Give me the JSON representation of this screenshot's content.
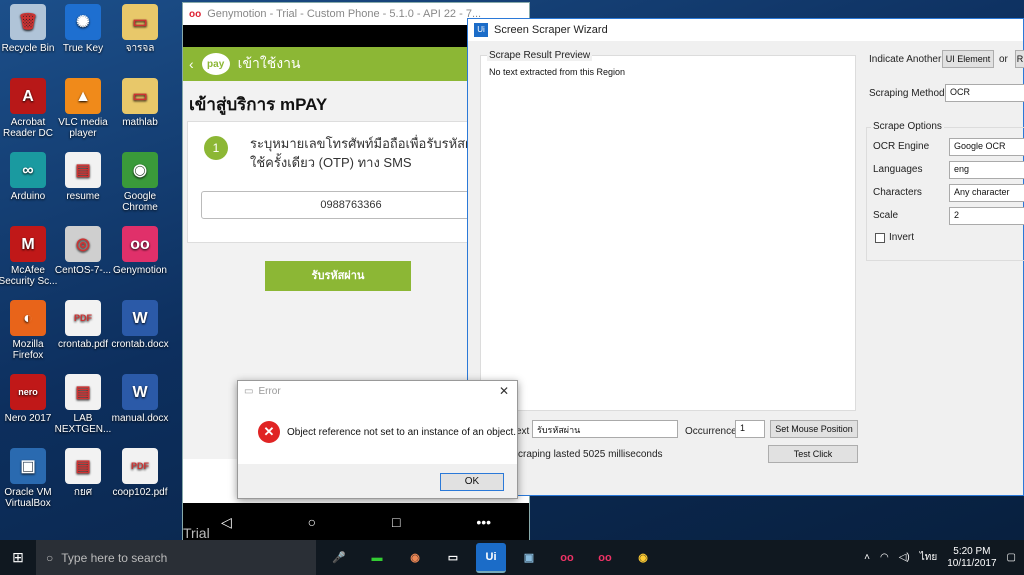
{
  "desktop": {
    "icons": [
      {
        "label": "Recycle Bin",
        "icon": "recycle-bin-icon",
        "color": "#b0c4d8",
        "glyph": "🗑"
      },
      {
        "label": "True Key",
        "icon": "true-key-icon",
        "color": "#1e6fd0",
        "glyph": "✺"
      },
      {
        "label": "จารจล",
        "icon": "folder-icon",
        "color": "#e8c86a",
        "glyph": "▭"
      },
      {
        "label": "Acrobat Reader DC",
        "icon": "acrobat-icon",
        "color": "#b81818",
        "glyph": "A"
      },
      {
        "label": "VLC media player",
        "icon": "vlc-icon",
        "color": "#f08a1a",
        "glyph": "▲"
      },
      {
        "label": "mathlab",
        "icon": "folder-icon",
        "color": "#e8c86a",
        "glyph": "▭"
      },
      {
        "label": "Arduino",
        "icon": "arduino-icon",
        "color": "#1a9aa0",
        "glyph": "∞"
      },
      {
        "label": "resume",
        "icon": "pdf-file-icon",
        "color": "#f2f2f2",
        "glyph": "▤"
      },
      {
        "label": "Google Chrome",
        "icon": "chrome-icon",
        "color": "#3a9a3a",
        "glyph": "◉"
      },
      {
        "label": "McAfee Security Sc...",
        "icon": "mcafee-icon",
        "color": "#c01818",
        "glyph": "M"
      },
      {
        "label": "CentOS-7-...",
        "icon": "disc-icon",
        "color": "#cfcfcf",
        "glyph": "◎"
      },
      {
        "label": "Genymotion",
        "icon": "genymotion-icon",
        "color": "#e0306a",
        "glyph": "oo"
      },
      {
        "label": "Mozilla Firefox",
        "icon": "firefox-icon",
        "color": "#e8641a",
        "glyph": "◐"
      },
      {
        "label": "crontab.pdf",
        "icon": "pdf-file-icon",
        "color": "#f2f2f2",
        "glyph": "PDF"
      },
      {
        "label": "crontab.docx",
        "icon": "word-file-icon",
        "color": "#2b5aa8",
        "glyph": "W"
      },
      {
        "label": "Nero 2017",
        "icon": "nero-icon",
        "color": "#c01818",
        "glyph": "nero"
      },
      {
        "label": "LAB NEXTGEN...",
        "icon": "file-icon",
        "color": "#f2f2f2",
        "glyph": "▤"
      },
      {
        "label": "manual.docx",
        "icon": "word-file-icon",
        "color": "#2b5aa8",
        "glyph": "W"
      },
      {
        "label": "Oracle VM VirtualBox",
        "icon": "virtualbox-icon",
        "color": "#2a6ab0",
        "glyph": "▣"
      },
      {
        "label": "กยศ",
        "icon": "file-icon",
        "color": "#f2f2f2",
        "glyph": "▤"
      },
      {
        "label": "coop102.pdf",
        "icon": "pdf-file-icon",
        "color": "#f2f2f2",
        "glyph": "PDF"
      }
    ]
  },
  "genymotion": {
    "title": "Genymotion - Trial - Custom Phone - 5.1.0 - API 22 - 7...",
    "app_header": "เข้าใช้งาน",
    "page_title": "เข้าสู่บริการ mPAY",
    "step_number": "1",
    "step_text": "ระบุหมายเลขโทรศัพท์มือถือเพื่อรับรหัสผ่านแบบใช้ครั้งเดียว (OTP) ทาง SMS",
    "phone_number": "0988763366",
    "otp_button": "รับรหัสผ่าน",
    "trial_label": "Trial",
    "logo_text": "pay"
  },
  "scraper": {
    "title": "Screen Scraper Wizard",
    "preview_label": "Scrape Result Preview",
    "preview_text": "No text extracted from this Region",
    "indicate_label": "Indicate Another",
    "ui_element_button": "UI Element",
    "or_label": "or",
    "r_button": "R",
    "method_label": "Scraping Method",
    "method_value": "OCR",
    "options_label": "Scrape Options",
    "engine_label": "OCR Engine",
    "engine_value": "Google OCR",
    "languages_label": "Languages",
    "languages_value": "eng",
    "characters_label": "Characters",
    "characters_value": "Any character",
    "scale_label": "Scale",
    "scale_value": "2",
    "invert_label": "Invert",
    "text_label": "ext",
    "text_value": "รับรหัสผ่าน",
    "occurrence_label": "Occurrence",
    "occurrence_value": "1",
    "set_mouse_button": "Set Mouse Position",
    "status_text": "craping lasted 5025 milliseconds",
    "test_click_button": "Test Click"
  },
  "error_dialog": {
    "title": "Error",
    "message": "Object reference not set to an instance of an object.",
    "ok_button": "OK"
  },
  "taskbar": {
    "search_placeholder": "Type here to search",
    "time": "5:20 PM",
    "date": "10/11/2017",
    "language": "ไทย"
  }
}
